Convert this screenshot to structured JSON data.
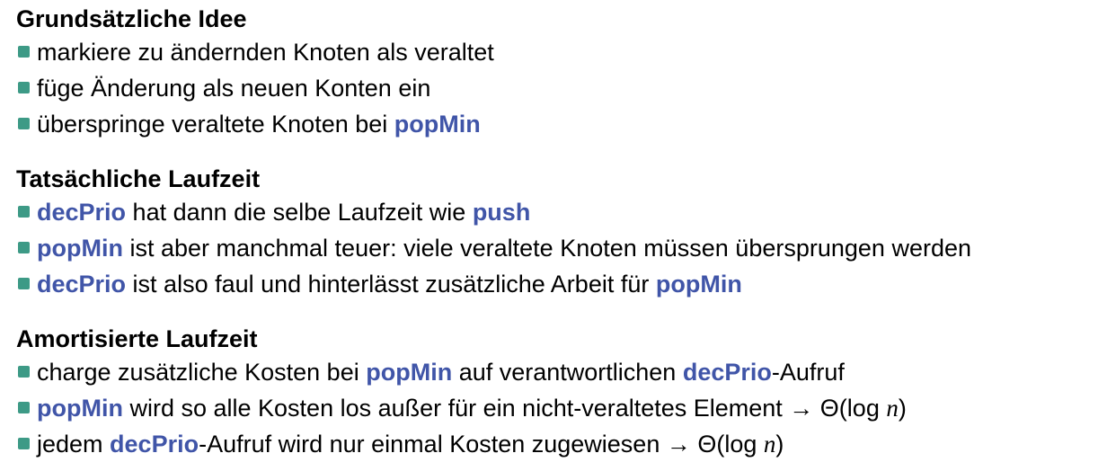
{
  "sections": [
    {
      "heading": "Grundsätzliche Idee",
      "items": [
        [
          {
            "t": "markiere zu ändernden Knoten als veraltet"
          }
        ],
        [
          {
            "t": "füge Änderung als neuen Konten ein"
          }
        ],
        [
          {
            "t": "überspringe veraltete Knoten bei "
          },
          {
            "t": "popMin",
            "kw": true
          }
        ]
      ]
    },
    {
      "heading": "Tatsächliche Laufzeit",
      "items": [
        [
          {
            "t": "decPrio",
            "kw": true
          },
          {
            "t": " hat dann die selbe Laufzeit wie "
          },
          {
            "t": "push",
            "kw": true
          }
        ],
        [
          {
            "t": "popMin",
            "kw": true
          },
          {
            "t": " ist aber manchmal teuer: viele veraltete Knoten müssen übersprungen werden"
          }
        ],
        [
          {
            "t": "decPrio",
            "kw": true
          },
          {
            "t": " ist also faul und hinterlässt zusätzliche Arbeit für "
          },
          {
            "t": "popMin",
            "kw": true
          }
        ]
      ]
    },
    {
      "heading": "Amortisierte Laufzeit",
      "items": [
        [
          {
            "t": "charge zusätzliche Kosten bei "
          },
          {
            "t": "popMin",
            "kw": true
          },
          {
            "t": " auf verantwortlichen "
          },
          {
            "t": "decPrio",
            "kw": true
          },
          {
            "t": "-Aufruf"
          }
        ],
        [
          {
            "t": "popMin",
            "kw": true
          },
          {
            "t": " wird so alle Kosten los außer für ein nicht-veraltetes Element → Θ(log "
          },
          {
            "t": "n",
            "math": true
          },
          {
            "t": ")"
          }
        ],
        [
          {
            "t": "jedem "
          },
          {
            "t": "decPrio",
            "kw": true
          },
          {
            "t": "-Aufruf wird nur einmal Kosten zugewiesen → Θ(log "
          },
          {
            "t": "n",
            "math": true
          },
          {
            "t": ")"
          }
        ]
      ]
    }
  ],
  "colors": {
    "bullet": "#3d9a86",
    "keyword": "#4055a8",
    "text": "#000000",
    "background": "#ffffff"
  },
  "icons": {
    "bullet": "square-bullet-icon"
  }
}
